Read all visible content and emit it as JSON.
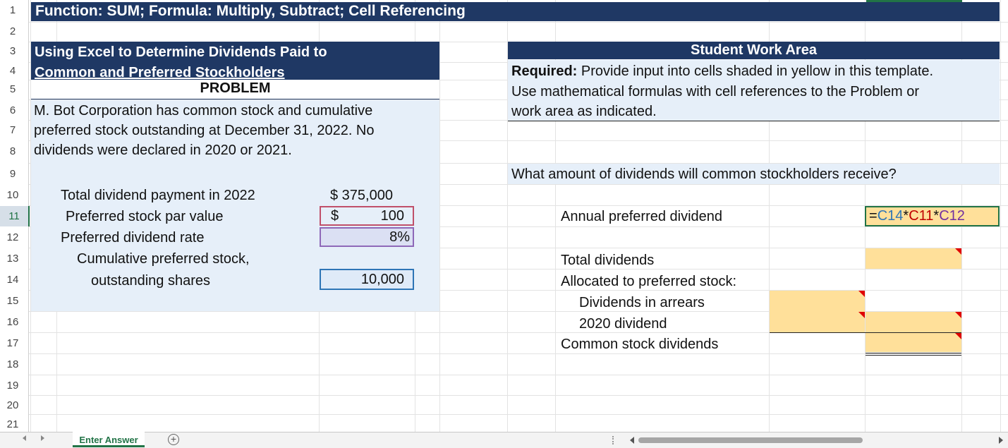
{
  "rows": [
    "1",
    "2",
    "3",
    "4",
    "5",
    "6",
    "7",
    "8",
    "9",
    "10",
    "11",
    "12",
    "13",
    "14",
    "15",
    "16",
    "17",
    "18",
    "19",
    "20",
    "21"
  ],
  "title_bar": "Function: SUM; Formula: Multiply, Subtract; Cell Referencing",
  "left_header": {
    "line1": "Using Excel to Determine Dividends Paid to",
    "line2": "Common and Preferred Stockholders"
  },
  "problem_label": "PROBLEM",
  "problem_text": {
    "line1": "M. Bot Corporation has common stock and cumulative",
    "line2": "preferred stock outstanding at December 31, 2022. No",
    "line3": "dividends were declared in 2020 or 2021."
  },
  "inputs": {
    "total_dividend_label": "Total dividend payment in 2022",
    "total_dividend_value": "$ 375,000",
    "par_label": "Preferred stock par value",
    "par_currency": "$",
    "par_value": "100",
    "rate_label": "Preferred dividend rate",
    "rate_value": "8%",
    "shares_label1": "Cumulative preferred stock,",
    "shares_label2": "outstanding shares",
    "shares_value": "10,000"
  },
  "work_area": {
    "header": "Student Work Area",
    "required_bold": "Required:",
    "required_line1": " Provide input into cells shaded in yellow in this template.",
    "required_line2": "Use mathematical formulas with cell references to the Problem or",
    "required_line3": "work area as indicated.",
    "question": "What amount of dividends will common stockholders receive?",
    "annual_label": "Annual preferred dividend",
    "formula": {
      "eq": "=",
      "r1": "C14",
      "op1": "*",
      "r2": "C11",
      "op2": "*",
      "r3": "C12"
    },
    "total_label": "Total dividends",
    "allocated_label": "Allocated to preferred stock:",
    "arrears_label": "Dividends in arrears",
    "dividend2020_label": "2020 dividend",
    "common_label": "Common stock dividends"
  },
  "sheet_tab": "Enter Answer",
  "add_sheet_glyph": "+",
  "colors": {
    "navy": "#1f3864",
    "light_blue": "#e6eff9",
    "yellow": "#ffe09a",
    "ref_blue": "#2e75b6",
    "ref_red": "#c00000",
    "excel_green": "#217346"
  }
}
